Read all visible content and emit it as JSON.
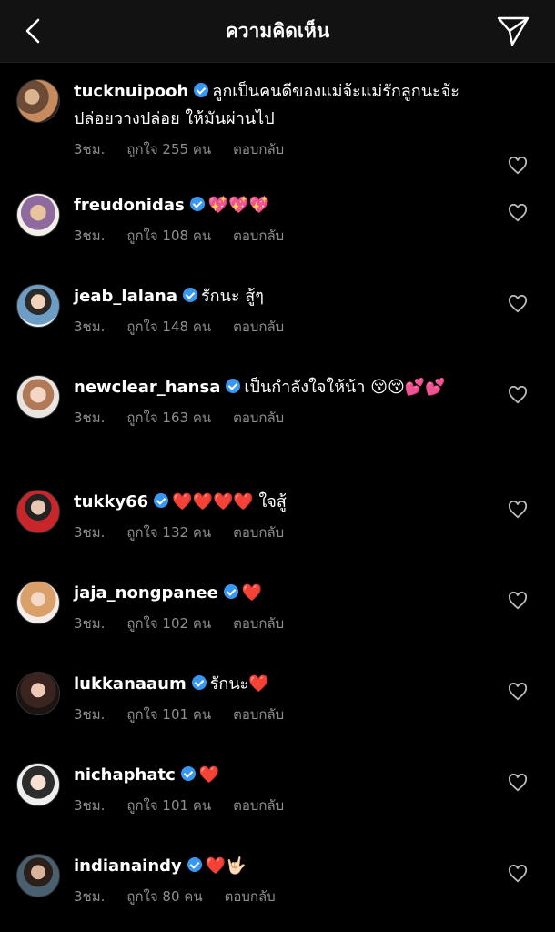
{
  "header": {
    "title": "ความคิดเห็น"
  },
  "icons": {
    "back": "chevron-left-icon",
    "send": "paper-plane-icon",
    "like": "heart-outline-icon",
    "verified": "verified-badge-icon"
  },
  "colors": {
    "background": "#000000",
    "header": "#121212",
    "verified": "#3897f0",
    "meta": "#8e8e8e"
  },
  "reply_label": "ตอบกลับ",
  "comments": [
    {
      "username": "tucknuipooh",
      "text": "ลูกเป็นคนดีของแม่จ้ะแม่รักลูกนะจ้ะ ปล่อยวางปล่อย ให้มันผ่านไป",
      "time": "3ชม.",
      "likes": "ถูกใจ 255 คน",
      "reply": "ตอบกลับ"
    },
    {
      "username": "freudonidas",
      "text": "💖💖💖",
      "time": "3ชม.",
      "likes": "ถูกใจ 108 คน",
      "reply": "ตอบกลับ"
    },
    {
      "username": "jeab_lalana",
      "text": "รักนะ สู้ๆ",
      "time": "3ชม.",
      "likes": "ถูกใจ 148 คน",
      "reply": "ตอบกลับ"
    },
    {
      "username": "newclear_hansa",
      "text": "เป็นกำลังใจให้น้า 😚😚💕💕",
      "time": "3ชม.",
      "likes": "ถูกใจ 163 คน",
      "reply": "ตอบกลับ"
    },
    {
      "username": "tukky66",
      "text": "❤️❤️❤️❤️ ใจสู้",
      "time": "3ชม.",
      "likes": "ถูกใจ 132 คน",
      "reply": "ตอบกลับ"
    },
    {
      "username": "jaja_nongpanee",
      "text": "❤️",
      "time": "3ชม.",
      "likes": "ถูกใจ 102 คน",
      "reply": "ตอบกลับ"
    },
    {
      "username": "lukkanaaum",
      "text": "รักนะ❤️",
      "time": "3ชม.",
      "likes": "ถูกใจ 101 คน",
      "reply": "ตอบกลับ"
    },
    {
      "username": "nichaphatc",
      "text": "❤️",
      "time": "3ชม.",
      "likes": "ถูกใจ 101 คน",
      "reply": "ตอบกลับ"
    },
    {
      "username": "indianaindy",
      "text": "❤️🤟🏻",
      "time": "3ชม.",
      "likes": "ถูกใจ 80 คน",
      "reply": "ตอบกลับ"
    }
  ]
}
